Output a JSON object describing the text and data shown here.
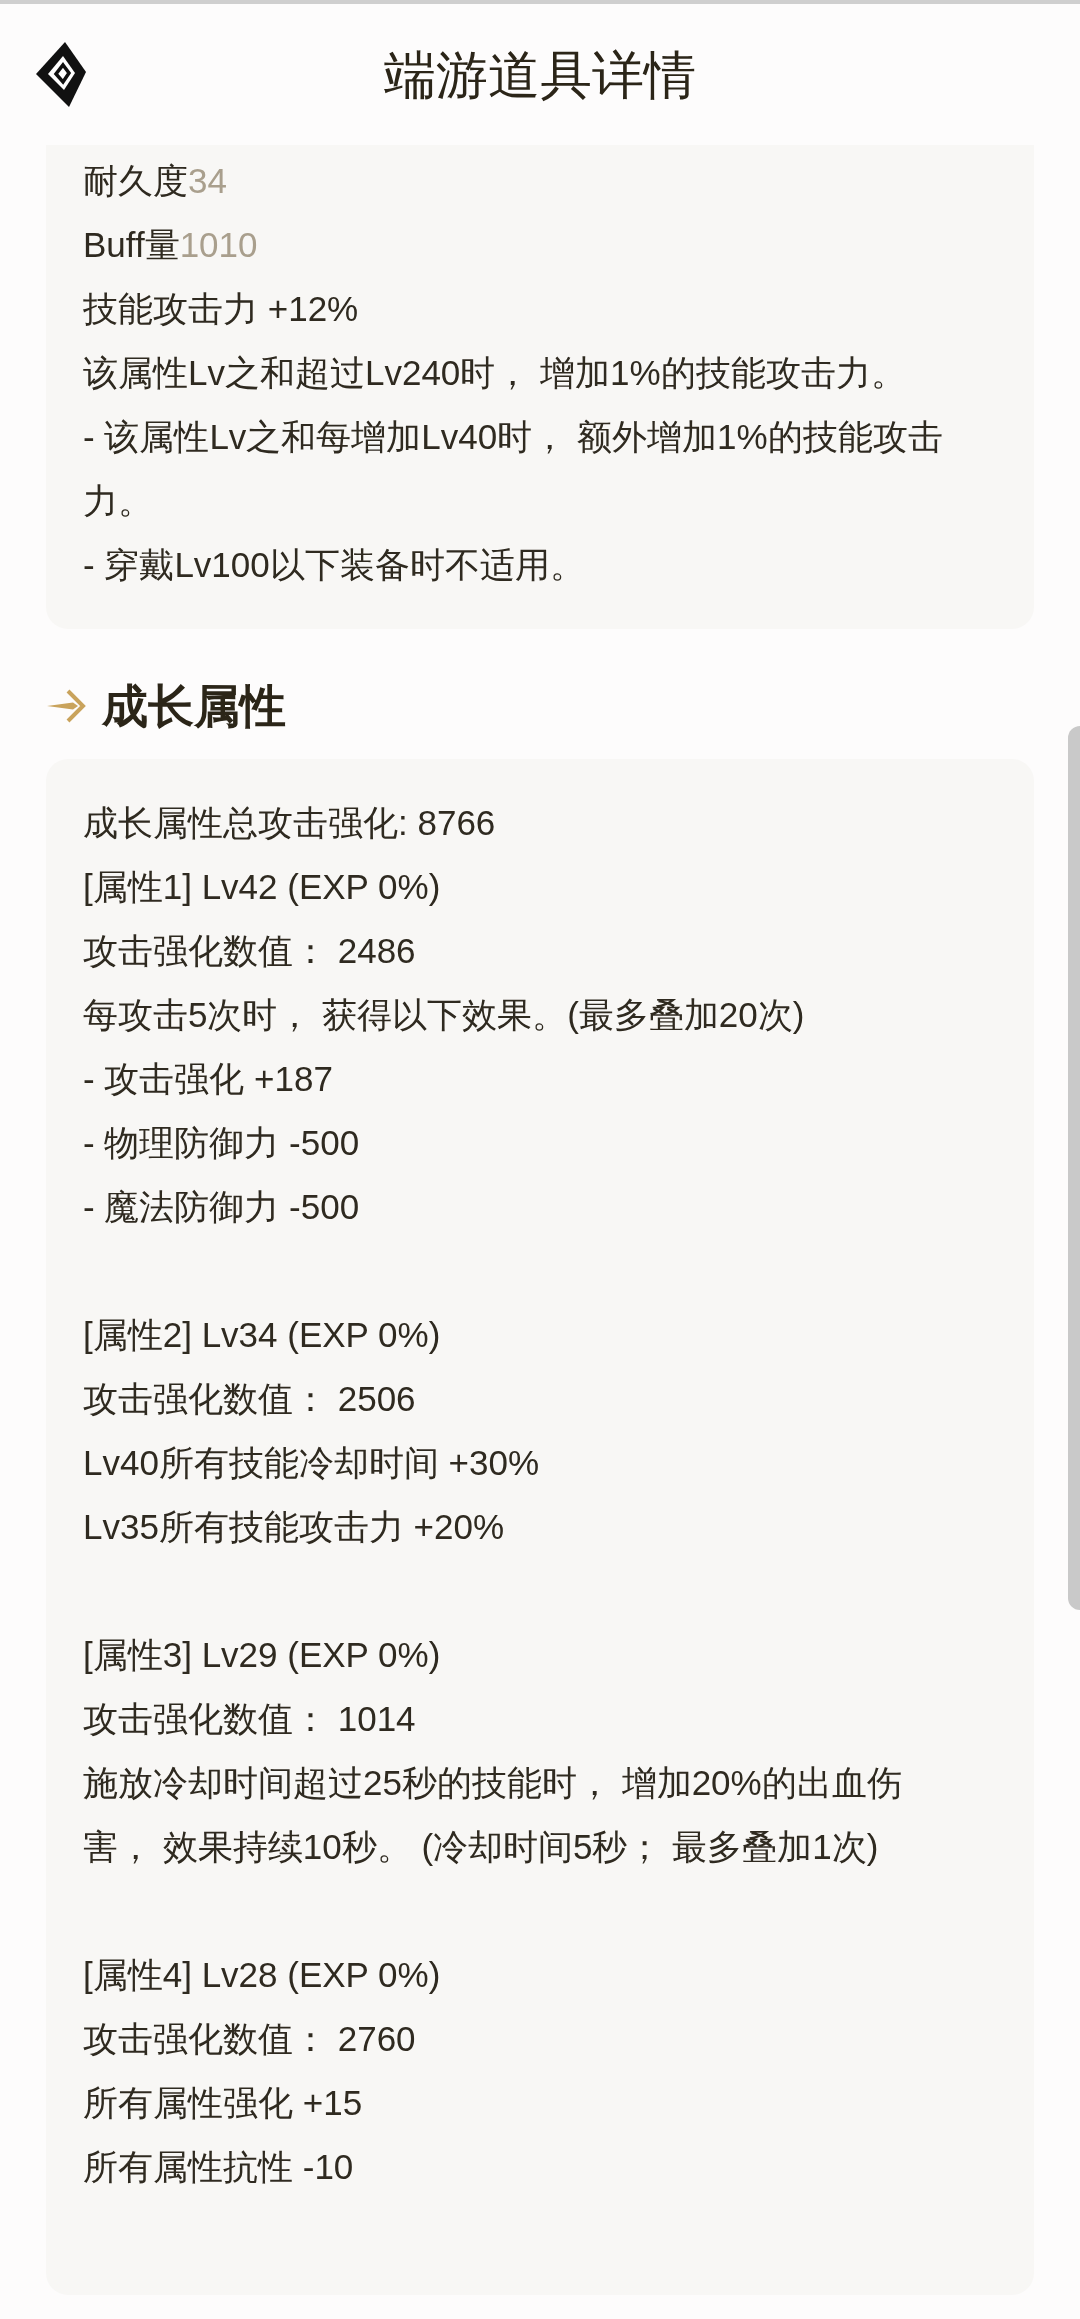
{
  "header": {
    "title": "端游道具详情"
  },
  "top_card": {
    "lines": [
      {
        "kind": "stat",
        "label": "耐久度",
        "value": "34"
      },
      {
        "kind": "stat",
        "label": "Buff量",
        "value": "1010"
      },
      {
        "kind": "text",
        "text": "技能攻击力 +12%"
      },
      {
        "kind": "text",
        "text": "该属性Lv之和超过Lv240时， 增加1%的技能攻击力。"
      },
      {
        "kind": "text",
        "text": "- 该属性Lv之和每增加Lv40时， 额外增加1%的技能攻击力。"
      },
      {
        "kind": "text",
        "text": "- 穿戴Lv100以下装备时不适用。"
      }
    ]
  },
  "growth_section": {
    "title": "成长属性",
    "groups": [
      {
        "lines": [
          "成长属性总攻击强化: 8766",
          "[属性1] Lv42 (EXP 0%)",
          "攻击强化数值： 2486",
          "每攻击5次时， 获得以下效果。(最多叠加20次)",
          "- 攻击强化 +187",
          "- 物理防御力 -500",
          "- 魔法防御力 -500"
        ]
      },
      {
        "lines": [
          "[属性2] Lv34 (EXP 0%)",
          "攻击强化数值： 2506",
          "Lv40所有技能冷却时间 +30%",
          "Lv35所有技能攻击力 +20%"
        ]
      },
      {
        "lines": [
          "[属性3] Lv29 (EXP 0%)",
          "攻击强化数值： 1014",
          "施放冷却时间超过25秒的技能时， 增加20%的出血伤害， 效果持续10秒。 (冷却时间5秒； 最多叠加1次)"
        ]
      },
      {
        "lines": [
          "[属性4] Lv28 (EXP 0%)",
          "攻击强化数值： 2760",
          "所有属性强化 +15",
          "所有属性抗性 -10"
        ]
      }
    ]
  }
}
